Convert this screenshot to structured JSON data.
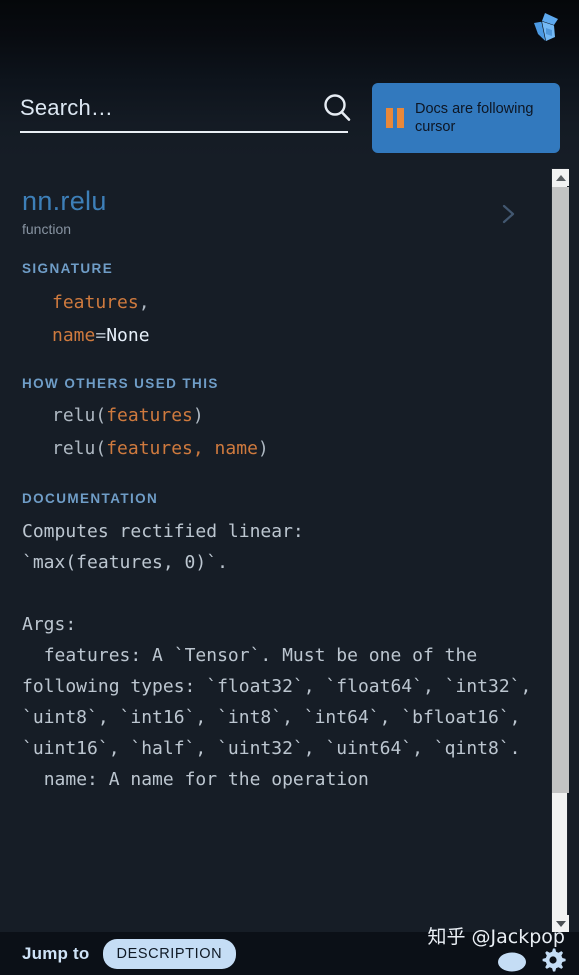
{
  "header": {
    "logo_icon": "kite-logo-icon",
    "search": {
      "value": "",
      "placeholder": "Search…",
      "icon": "search-icon"
    },
    "follow_button": {
      "label": "Docs are following cursor",
      "icon": "pause-icon",
      "bg_color": "#3279be",
      "icon_color": "#e8883a"
    }
  },
  "doc": {
    "title": "nn.relu",
    "kind": "function",
    "title_color": "#3d7fb8",
    "nav": {
      "prev_icon": "chevron-left-icon",
      "next_icon": "chevron-right-icon"
    },
    "sections": {
      "signature_label": "SIGNATURE",
      "usage_label": "HOW OTHERS USED THIS",
      "documentation_label": "DOCUMENTATION"
    },
    "signature": {
      "line1_param": "features",
      "line1_punct": ",",
      "line2_param": "name",
      "line2_eq": "=",
      "line2_value": "None"
    },
    "usages": [
      {
        "fn": "relu(",
        "args": "features",
        "close": ")"
      },
      {
        "fn": "relu(",
        "args": "features, name",
        "close": ")"
      }
    ],
    "documentation": "Computes rectified linear:\n`max(features, 0)`.\n\nArgs:\n  features: A `Tensor`. Must be one of the following types: `float32`, `float64`, `int32`, `uint8`, `int16`, `int8`, `int64`, `bfloat16`, `uint16`, `half`, `uint32`, `uint64`, `qint8`.\n  name: A name for the operation"
  },
  "scrollbar": {
    "up_icon": "triangle-up-icon",
    "down_icon": "triangle-down-icon"
  },
  "footer": {
    "jump_label": "Jump to",
    "jump_target": "DESCRIPTION",
    "bubble_icon": "speech-bubble-icon",
    "gear_icon": "gear-icon"
  },
  "watermark": "知乎 @Jackpop"
}
